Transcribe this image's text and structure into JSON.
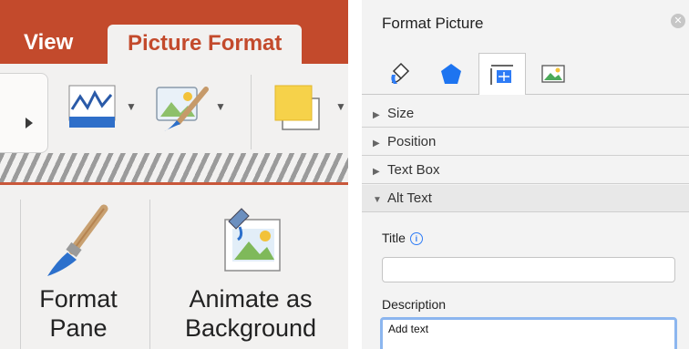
{
  "ribbon": {
    "tabs": [
      {
        "label": "View"
      },
      {
        "label": "Picture Format",
        "active": true
      }
    ],
    "big_buttons": [
      {
        "line1": "Format",
        "line2": "Pane"
      },
      {
        "line1": "Animate as",
        "line2": "Background"
      }
    ],
    "icons": [
      "collapse-arrow-icon",
      "picture-corrections-icon",
      "artistic-effects-icon",
      "picture-color-icon"
    ],
    "colors": {
      "accent": "#c34a2c",
      "ribbon_bg": "#f2f1f0"
    }
  },
  "pane": {
    "title": "Format Picture",
    "close_icon": "close-icon",
    "icon_tabs": [
      {
        "name": "fill-line-icon"
      },
      {
        "name": "effects-icon"
      },
      {
        "name": "size-properties-icon",
        "active": true
      },
      {
        "name": "picture-icon"
      }
    ],
    "sections": [
      {
        "label": "Size",
        "expanded": false
      },
      {
        "label": "Position",
        "expanded": false
      },
      {
        "label": "Text Box",
        "expanded": false
      },
      {
        "label": "Alt Text",
        "expanded": true
      }
    ],
    "alt_text": {
      "title_label": "Title",
      "title_value": "",
      "description_label": "Description",
      "description_value": "Add text"
    }
  }
}
